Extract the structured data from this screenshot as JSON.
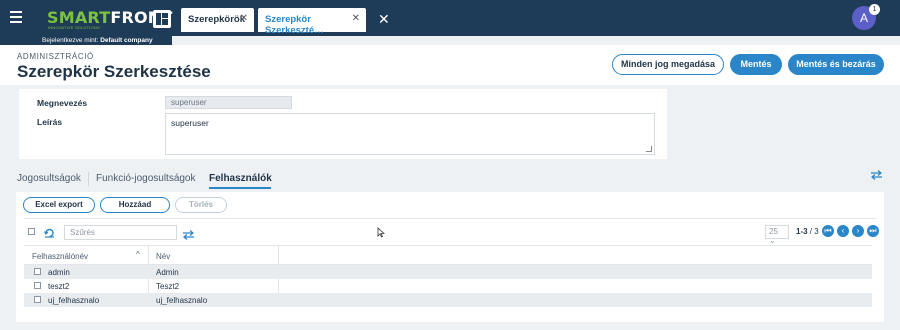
{
  "topbar": {
    "logo_primary": "SMART",
    "logo_secondary": "FRONT",
    "logo_tagline": "INNOVATIVE SOLUTIONS",
    "tabs": [
      {
        "label": "Szerepkörök"
      },
      {
        "label": "Szerepkör Szerkeszté…"
      }
    ],
    "avatar_initial": "A",
    "notification_count": "1",
    "logged_in_prefix": "Bejelentkezve mint:",
    "logged_in_company": "Default company"
  },
  "header": {
    "breadcrumb": "ADMINISZTRÁCIÓ",
    "title": "Szerepkör Szerkesztése",
    "buttons": {
      "grant_all": "Minden jog megadása",
      "save": "Mentés",
      "save_close": "Mentés és bezárás"
    }
  },
  "form": {
    "name_label": "Megnevezés",
    "name_value": "superuser",
    "desc_label": "Leírás",
    "desc_value": "superuser"
  },
  "subtabs": [
    {
      "label": "Jogosultságok"
    },
    {
      "label": "Funkció-jogosultságok"
    },
    {
      "label": "Felhasználók"
    }
  ],
  "actions": {
    "excel_export": "Excel export",
    "add": "Hozzáad",
    "delete": "Törlés"
  },
  "grid": {
    "filter_placeholder": "Szűrés",
    "page_size": "25",
    "range": "1-3",
    "total": "/ 3",
    "columns": [
      "Felhasználónév",
      "Név"
    ],
    "rows": [
      {
        "username": "admin",
        "name": "Admin"
      },
      {
        "username": "teszt2",
        "name": "Teszt2"
      },
      {
        "username": "uj_felhasznalo",
        "name": "uj_felhasznalo"
      }
    ]
  },
  "colors": {
    "topbar": "#1e3b57",
    "accent": "#2a86c9",
    "logo_green": "#7cc242",
    "avatar": "#5b5fc7"
  }
}
